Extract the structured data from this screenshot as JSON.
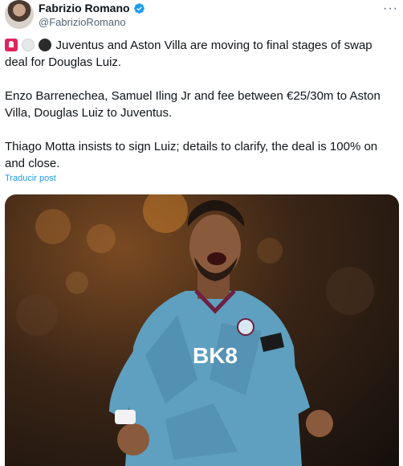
{
  "author": {
    "display_name": "Fabrizio Romano",
    "handle": "@FabrizioRomano"
  },
  "more_label": "···",
  "tweet": {
    "emojis": [
      "siren-emoji",
      "white-circle-emoji",
      "black-circle-emoji"
    ],
    "paragraph_1": "Juventus and Aston Villa are moving to final stages of swap deal for Douglas Luiz.",
    "paragraph_2": "Enzo Barrenechea, Samuel Iling Jr and fee between €25/30m to Aston Villa, Douglas Luiz to Juventus.",
    "paragraph_3": "Thiago Motta insists to sign Luiz; details to clarify, the deal is 100% on and close."
  },
  "translate_label": "Traducir post",
  "media": {
    "shirt_sponsor": "BK8",
    "colors": {
      "shirt": "#5f9fbf",
      "background": "#2a1c12",
      "accent": "#1d9bf0"
    }
  }
}
